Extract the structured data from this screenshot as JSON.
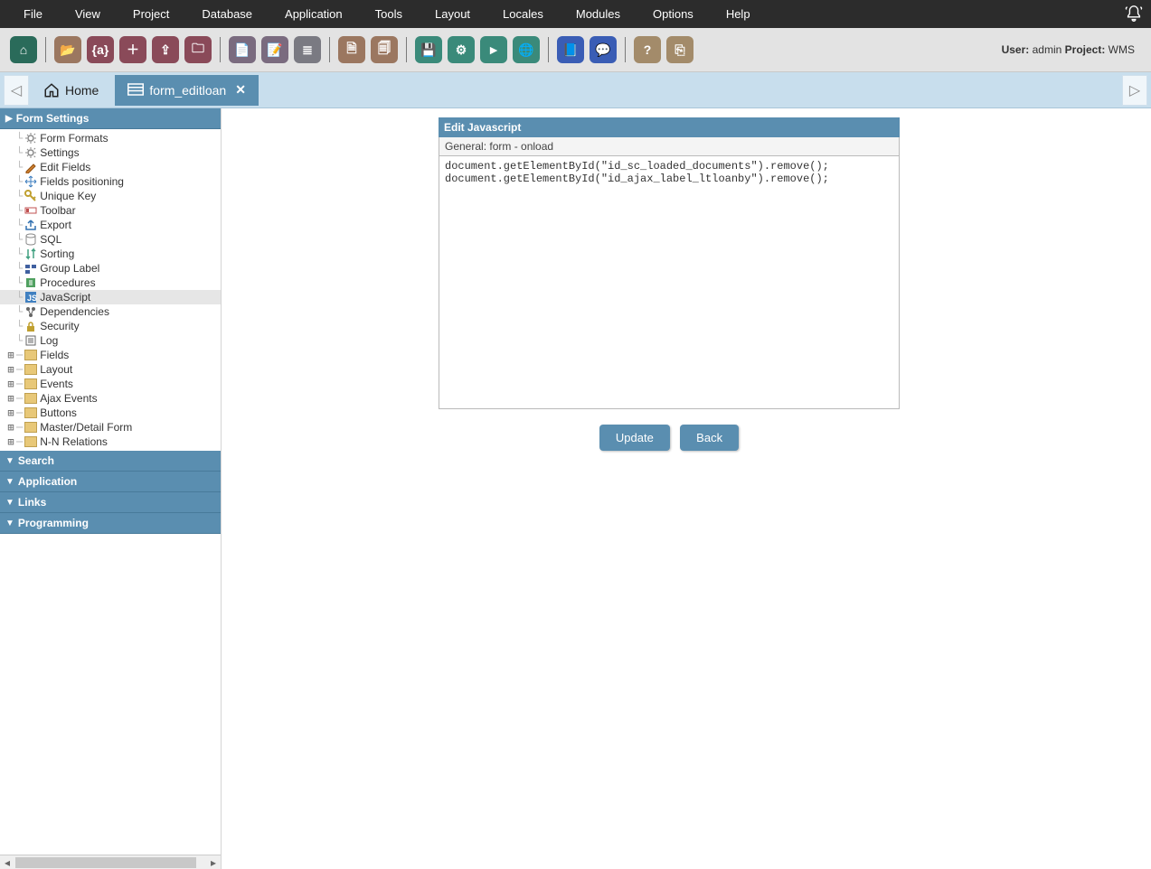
{
  "menubar": [
    "File",
    "View",
    "Project",
    "Database",
    "Application",
    "Tools",
    "Layout",
    "Locales",
    "Modules",
    "Options",
    "Help"
  ],
  "user": {
    "user_label": "User:",
    "user_value": "admin",
    "project_label": "Project:",
    "project_value": "WMS"
  },
  "tabs": {
    "home": "Home",
    "active": "form_editloan"
  },
  "sidebar": {
    "form_settings_header": "Form Settings",
    "items": [
      {
        "label": "Form Formats",
        "icon": "gear"
      },
      {
        "label": "Settings",
        "icon": "gear"
      },
      {
        "label": "Edit Fields",
        "icon": "pencil"
      },
      {
        "label": "Fields positioning",
        "icon": "move"
      },
      {
        "label": "Unique Key",
        "icon": "key"
      },
      {
        "label": "Toolbar",
        "icon": "toolbar"
      },
      {
        "label": "Export",
        "icon": "export"
      },
      {
        "label": "SQL",
        "icon": "db"
      },
      {
        "label": "Sorting",
        "icon": "sort"
      },
      {
        "label": "Group Label",
        "icon": "group"
      },
      {
        "label": "Procedures",
        "icon": "proc"
      },
      {
        "label": "JavaScript",
        "icon": "js",
        "selected": true
      },
      {
        "label": "Dependencies",
        "icon": "dep"
      },
      {
        "label": "Security",
        "icon": "lock"
      },
      {
        "label": "Log",
        "icon": "log"
      }
    ],
    "folders": [
      "Fields",
      "Layout",
      "Events",
      "Ajax Events",
      "Buttons",
      "Master/Detail Form",
      "N-N Relations"
    ],
    "collapsed": [
      "Search",
      "Application",
      "Links",
      "Programming"
    ]
  },
  "editor": {
    "title": "Edit Javascript",
    "subtitle": "General: form - onload",
    "code": "document.getElementById(\"id_sc_loaded_documents\").remove();\ndocument.getElementById(\"id_ajax_label_ltloanby\").remove();"
  },
  "buttons": {
    "update": "Update",
    "back": "Back"
  },
  "toolbar_icons": [
    {
      "name": "home",
      "color": "c-green"
    },
    {
      "name": "sep"
    },
    {
      "name": "open",
      "color": "c-brown"
    },
    {
      "name": "brace",
      "color": "c-red"
    },
    {
      "name": "plus",
      "color": "c-red"
    },
    {
      "name": "box",
      "color": "c-red"
    },
    {
      "name": "folder",
      "color": "c-red"
    },
    {
      "name": "sep"
    },
    {
      "name": "page-plus",
      "color": "c-purple"
    },
    {
      "name": "page-edit",
      "color": "c-purple"
    },
    {
      "name": "stack",
      "color": "c-gray"
    },
    {
      "name": "sep"
    },
    {
      "name": "doc",
      "color": "c-brown"
    },
    {
      "name": "doc2",
      "color": "c-brown"
    },
    {
      "name": "sep"
    },
    {
      "name": "save",
      "color": "c-teal"
    },
    {
      "name": "gear",
      "color": "c-teal"
    },
    {
      "name": "play",
      "color": "c-teal"
    },
    {
      "name": "globe",
      "color": "c-teal"
    },
    {
      "name": "sep"
    },
    {
      "name": "book",
      "color": "c-blue"
    },
    {
      "name": "chat",
      "color": "c-blue"
    },
    {
      "name": "sep"
    },
    {
      "name": "help",
      "color": "c-tan"
    },
    {
      "name": "exit",
      "color": "c-tan"
    }
  ]
}
